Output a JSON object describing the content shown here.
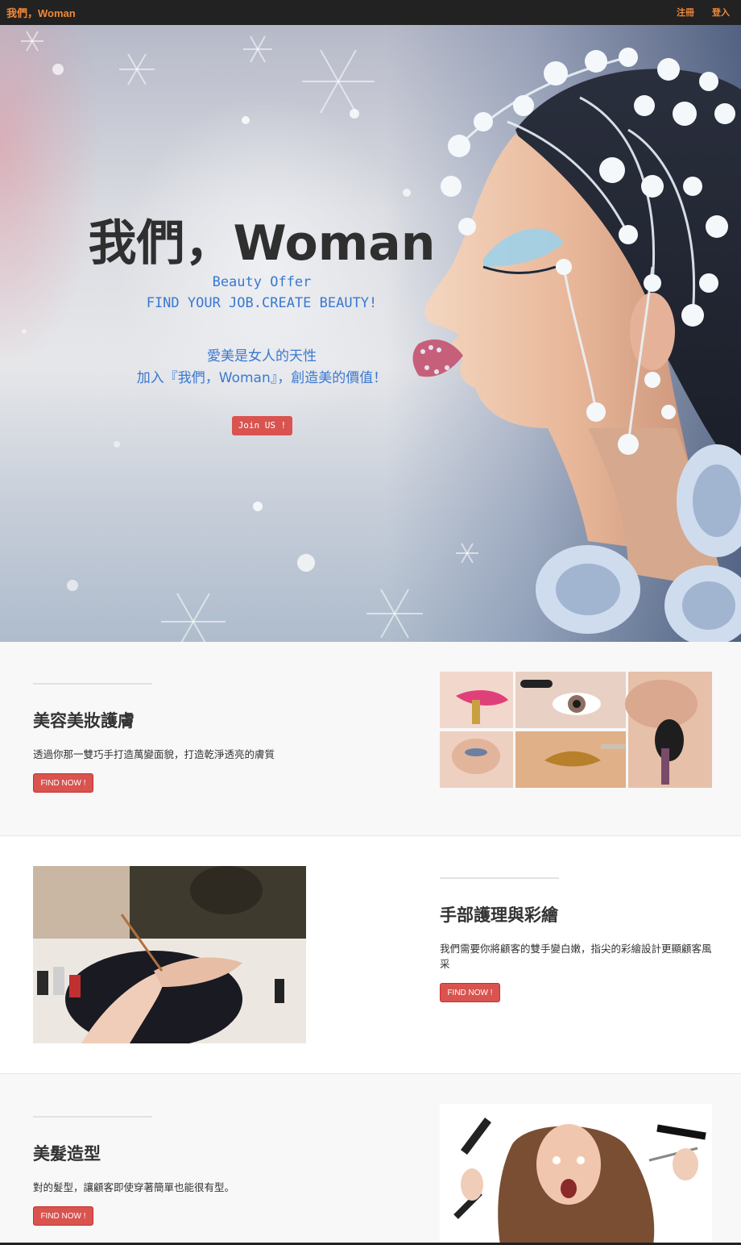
{
  "navbar": {
    "brand": "我們，Woman",
    "links": [
      "注冊",
      "登入"
    ],
    "accent": "#f0883a",
    "background": "#222222"
  },
  "hero": {
    "title": "我們，Woman",
    "subtitle1": "Beauty Offer",
    "subtitle2": "FIND YOUR JOB.CREATE BEAUTY!",
    "tagline1": "愛美是女人的天性",
    "tagline2": "加入『我們，Woman』，創造美的價值！",
    "button": "Join US !"
  },
  "sections": [
    {
      "title": "美容美妝護膚",
      "text": "透過你那一雙巧手打造萬變面貌，打造乾淨透亮的膚質",
      "button": "FIND NOW !"
    },
    {
      "title": "手部護理與彩繪",
      "text": "我們需要你將顧客的雙手變白嫩，指尖的彩繪設計更顯顧客風采",
      "button": "FIND NOW !"
    },
    {
      "title": "美髮造型",
      "text": "對的髮型，讓顧客即使穿著簡單也能很有型。",
      "button": "FIND NOW !"
    }
  ],
  "colors": {
    "button": "#d9534f",
    "hero_text_blue": "#3a78d0"
  }
}
